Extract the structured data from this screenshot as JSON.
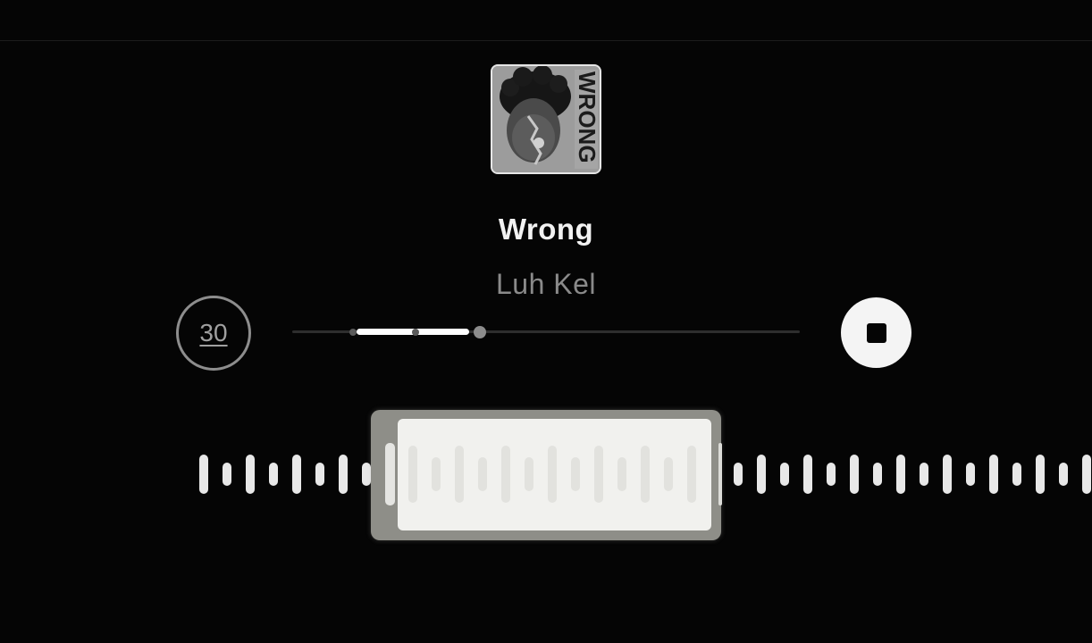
{
  "song": {
    "title": "Wrong",
    "artist": "Luh Kel"
  },
  "album_art": {
    "cover_text": "WRONG",
    "icon": "album-cover-image"
  },
  "duration_button": {
    "label": "30"
  },
  "playback": {
    "state": "playing",
    "progress_fraction": 0.37,
    "selection_start_fraction": 0.12,
    "icon": "stop-icon"
  },
  "colors": {
    "background": "#050505",
    "title": "#f2f2f2",
    "artist": "#8a8a8a",
    "accent": "#ffffff"
  }
}
